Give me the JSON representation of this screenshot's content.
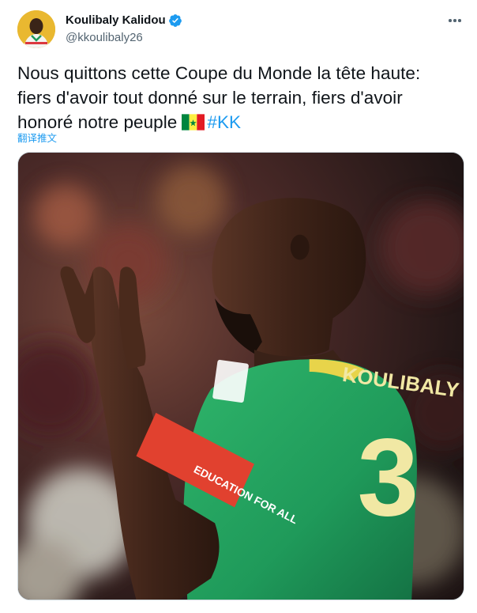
{
  "author": {
    "display_name": "Koulibaly Kalidou",
    "handle": "@kkoulibaly26",
    "verified": true,
    "avatar_icon": "user-avatar"
  },
  "menu": {
    "icon": "more-horizontal-icon"
  },
  "tweet": {
    "line1": "Nous quittons cette Coupe du Monde la tête haute:",
    "line2": "fiers d'avoir tout donné sur le terrain, fiers d'avoir",
    "line3": "honoré notre peuple",
    "flag": "senegal-flag-emoji",
    "hashtag": "#KK"
  },
  "translate_label": "翻译推文",
  "media": {
    "jersey_name": "KOULIBALY",
    "jersey_number": "3",
    "armband_text": "EDUCATION FOR ALL"
  },
  "colors": {
    "link": "#1d9bf0",
    "secondary_text": "#536471",
    "primary_text": "#0f1419",
    "jersey_green": "#1f9a5a"
  }
}
